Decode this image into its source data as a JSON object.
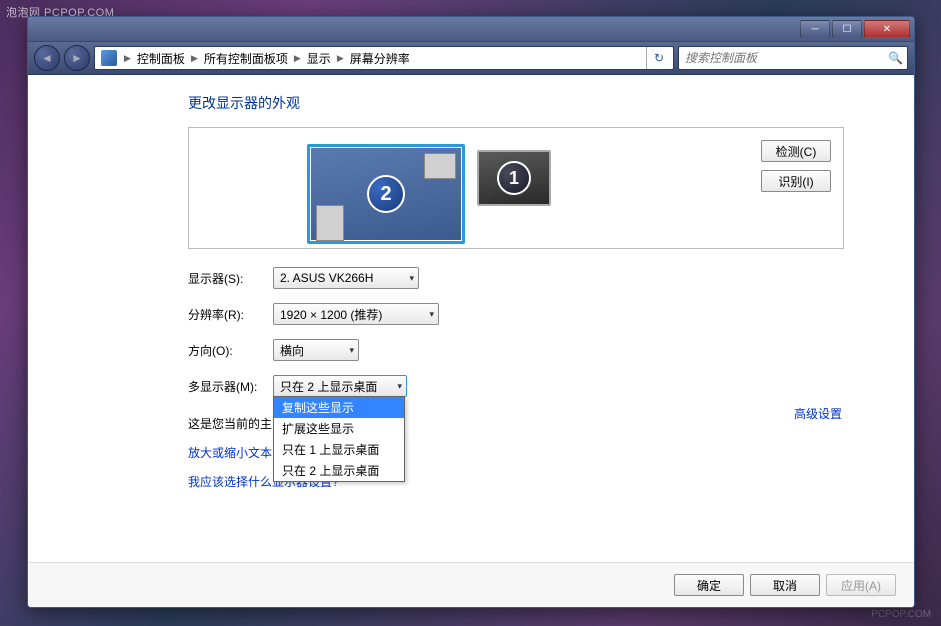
{
  "watermark_tl": "泡泡网  PCPOP.COM",
  "watermark_br": "PCPOP.COM",
  "breadcrumbs": [
    "控制面板",
    "所有控制面板项",
    "显示",
    "屏幕分辨率"
  ],
  "search_placeholder": "搜索控制面板",
  "heading": "更改显示器的外观",
  "monitor_numbers": {
    "primary": "2",
    "secondary": "1"
  },
  "side_buttons": {
    "detect": "检测(C)",
    "identify": "识别(I)"
  },
  "form": {
    "display_label": "显示器(S):",
    "display_value": "2. ASUS VK266H",
    "resolution_label": "分辨率(R):",
    "resolution_value": "1920 × 1200 (推荐)",
    "orientation_label": "方向(O):",
    "orientation_value": "横向",
    "multi_label": "多显示器(M):",
    "multi_value": "只在 2 上显示桌面"
  },
  "multi_options": [
    "复制这些显示",
    "扩展这些显示",
    "只在 1 上显示桌面",
    "只在 2 上显示桌面"
  ],
  "note_text": "这是您当前的主",
  "link_zoom": "放大或缩小文本",
  "link_help": "我应该选择什么显示器设置?",
  "advanced": "高级设置",
  "footer": {
    "ok": "确定",
    "cancel": "取消",
    "apply": "应用(A)"
  }
}
